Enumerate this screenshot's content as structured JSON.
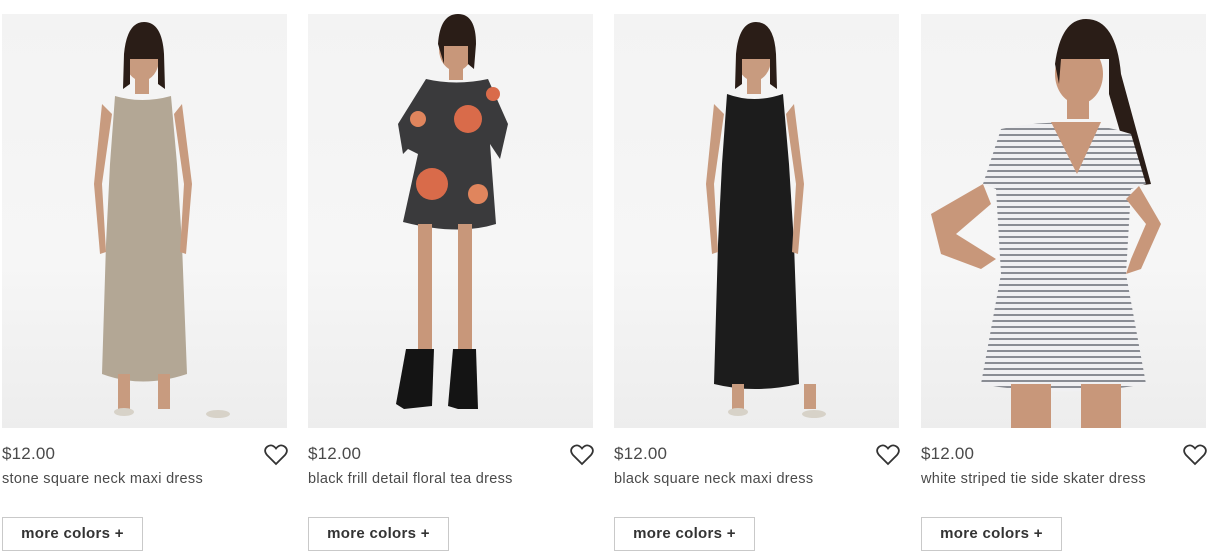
{
  "products": [
    {
      "price": "$12.00",
      "name": "stone square neck maxi dress",
      "more_colors_label": "more colors +",
      "dress_color": "#b3a795"
    },
    {
      "price": "$12.00",
      "name": "black frill detail floral tea dress",
      "more_colors_label": "more colors +",
      "dress_color": "#3a3a3c"
    },
    {
      "price": "$12.00",
      "name": "black square neck maxi dress",
      "more_colors_label": "more colors +",
      "dress_color": "#1c1c1c"
    },
    {
      "price": "$12.00",
      "name": "white striped tie side skater dress",
      "more_colors_label": "more colors +",
      "dress_color": "#e8e8ea"
    }
  ],
  "icons": {
    "wishlist": "heart-outline-icon"
  }
}
